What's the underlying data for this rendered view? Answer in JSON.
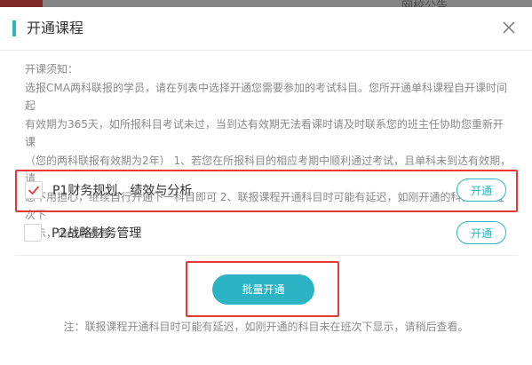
{
  "background": {
    "visible_text": "网校公告"
  },
  "dialog": {
    "title": "开通课程",
    "close_icon": "close-icon",
    "notice_lines": [
      "开课须知：",
      "选报CMA两科联报的学员，请在列表中选择开通您需要参加的考试科目。您所开通单科课程自开课时间起",
      "有效期为365天，如所报科目考试未过，当到达有效期无法看课时请及时联系您的班主任协助您重新开课",
      "（您的两科联报有效期为2年） 1、若您在所报科目的相应考期中顺利通过考试，且单科未到达有效期，请",
      "您不用担心，继续自行开通下一科目即可 2、联报课程开通科目时可能有延迟，如刚开通的科目未在班次下",
      "显示，请稍后查看。"
    ],
    "courses": [
      {
        "name": "P1财务规划、绩效与分析",
        "checked": true,
        "button_label": "开通"
      },
      {
        "name": "P2战略财务管理",
        "checked": false,
        "button_label": "开通"
      }
    ],
    "batch_button_label": "批量开通",
    "footnote": "注：联报课程开通科目时可能有延迟，如刚开通的科目未在班次下显示，请稍后查看。"
  },
  "colors": {
    "accent": "#2cb4c4",
    "highlight_border": "#e53935",
    "check_mark": "#e53935"
  }
}
